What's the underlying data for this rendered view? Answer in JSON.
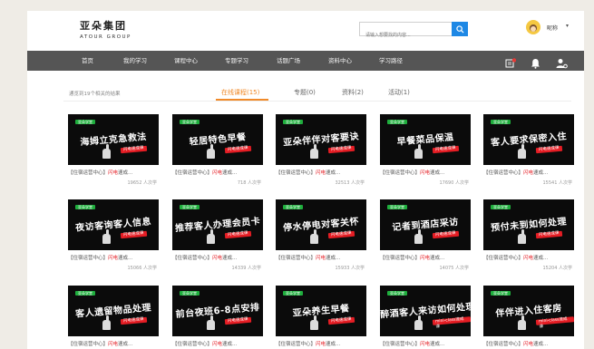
{
  "header": {
    "logo_cn": "亚朵集团",
    "logo_en": "ATOUR GROUP",
    "search_placeholder": "请输入想要找的内容...",
    "user_name": "昵称"
  },
  "nav": {
    "items": [
      "首页",
      "我的学习",
      "课程中心",
      "专题学习",
      "话题广场",
      "资料中心",
      "学习路径"
    ],
    "notification_badge": "5"
  },
  "subbar": {
    "hint": "通览到19个相关的结果",
    "tabs": [
      {
        "label": "在线课程(15)",
        "active": true
      },
      {
        "label": "专题(0)",
        "active": false
      },
      {
        "label": "资料(2)",
        "active": false
      },
      {
        "label": "活动(1)",
        "active": false
      }
    ]
  },
  "courses": [
    {
      "title": "海姆立克急救法",
      "tag": "亚朵学堂",
      "sub": "闪电速成课",
      "meta_prefix": "【住宿运营中心】",
      "meta_highlight": "闪电",
      "meta_suffix": "速成...",
      "views": "19652 人次学"
    },
    {
      "title": "轻居特色早餐",
      "tag": "亚朵学堂",
      "sub": "闪电速成课",
      "meta_prefix": "【住宿运营中心】",
      "meta_highlight": "闪电",
      "meta_suffix": "速成...",
      "views": "718 人次学"
    },
    {
      "title": "亚朵伴伴对客要诀",
      "tag": "亚朵学堂",
      "sub": "闪电速成课",
      "meta_prefix": "【住宿运营中心】",
      "meta_highlight": "闪电",
      "meta_suffix": "速成...",
      "views": "32513 人次学"
    },
    {
      "title": "早餐菜品保温",
      "tag": "亚朵学堂",
      "sub": "闪电速成课",
      "meta_prefix": "【住宿运营中心】",
      "meta_highlight": "闪电",
      "meta_suffix": "速成...",
      "views": "17690 人次学"
    },
    {
      "title": "客人要求保密入住",
      "tag": "亚朵学堂",
      "sub": "闪电速成课",
      "meta_prefix": "【住宿运营中心】",
      "meta_highlight": "闪电",
      "meta_suffix": "速成...",
      "views": "15541 人次学"
    },
    {
      "title": "夜访客询客人信息",
      "tag": "亚朵学堂",
      "sub": "闪电速成课",
      "meta_prefix": "【住宿运营中心】",
      "meta_highlight": "闪电",
      "meta_suffix": "速成...",
      "views": "15066 人次学"
    },
    {
      "title": "推荐客人办理会员卡",
      "tag": "亚朵学堂",
      "sub": "闪电速成课",
      "meta_prefix": "【住宿运营中心】",
      "meta_highlight": "闪电",
      "meta_suffix": "速成...",
      "views": "14339 人次学"
    },
    {
      "title": "停水停电对客关怀",
      "tag": "亚朵学堂",
      "sub": "闪电速成课",
      "meta_prefix": "【住宿运营中心】",
      "meta_highlight": "闪电",
      "meta_suffix": "速成...",
      "views": "15933 人次学"
    },
    {
      "title": "记者到酒店采访",
      "tag": "亚朵学堂",
      "sub": "闪电速成课",
      "meta_prefix": "【住宿运营中心】",
      "meta_highlight": "闪电",
      "meta_suffix": "速成...",
      "views": "14075 人次学"
    },
    {
      "title": "预付未到如何处理",
      "tag": "亚朵学堂",
      "sub": "闪电速成课",
      "meta_prefix": "【住宿运营中心】",
      "meta_highlight": "闪电",
      "meta_suffix": "速成...",
      "views": "15204 人次学"
    },
    {
      "title": "客人遗留物品处理",
      "tag": "亚朵学堂",
      "sub": "闪电速成课",
      "meta_prefix": "【住宿运营中心】",
      "meta_highlight": "闪电",
      "meta_suffix": "速成...",
      "views": ""
    },
    {
      "title": "前台夜班6-8点安排",
      "tag": "亚朵学堂",
      "sub": "闪电速成课",
      "meta_prefix": "【住宿运营中心】",
      "meta_highlight": "闪电",
      "meta_suffix": "速成...",
      "views": ""
    },
    {
      "title": "亚朵养生早餐",
      "tag": "亚朵学堂",
      "sub": "闪电速成课",
      "meta_prefix": "【住宿运营中心】",
      "meta_highlight": "闪电",
      "meta_suffix": "速成...",
      "views": ""
    },
    {
      "title": "醉酒客人来访如何处理",
      "tag": "亚朵学堂",
      "sub": "mini-class速成课",
      "meta_prefix": "【住宿运营中心】",
      "meta_highlight": "闪电",
      "meta_suffix": "速成...",
      "views": ""
    },
    {
      "title": "伴伴进入住客房",
      "tag": "亚朵学堂",
      "sub": "mini-class速成课",
      "meta_prefix": "【住宿运营中心】",
      "meta_highlight": "闪电",
      "meta_suffix": "速成...",
      "views": ""
    }
  ]
}
